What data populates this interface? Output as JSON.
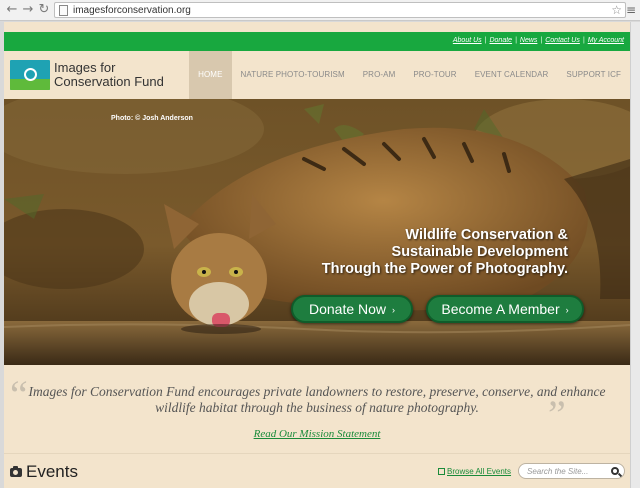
{
  "browser": {
    "url": "imagesforconservation.org",
    "back_glyph": "←",
    "forward_glyph": "→",
    "reload_glyph": "↻",
    "star_glyph": "☆",
    "menu_glyph": "≡"
  },
  "utility_links": [
    "About Us",
    "Donate",
    "News",
    "Contact Us",
    "My Account"
  ],
  "utility_separator": "|",
  "logo": {
    "line1": "Images for",
    "line2": "Conservation Fund",
    "colors": {
      "teal": "#1fa2b3",
      "green": "#5fba3b"
    }
  },
  "nav": {
    "items": [
      {
        "label": "HOME",
        "active": true
      },
      {
        "label": "NATURE PHOTO-TOURISM",
        "active": false
      },
      {
        "label": "PRO-AM",
        "active": false
      },
      {
        "label": "PRO-TOUR",
        "active": false
      },
      {
        "label": "EVENT CALENDAR",
        "active": false
      },
      {
        "label": "SUPPORT ICF",
        "active": false
      }
    ]
  },
  "hero": {
    "credit": "Photo: © Josh Anderson",
    "tagline_lines": [
      "Wildlife Conservation &",
      "Sustainable Development",
      "Through the Power of Photography."
    ],
    "donate_label": "Donate Now",
    "member_label": "Become A Member",
    "button_arrow": "›",
    "button_color": "#1e7d3f"
  },
  "mission": {
    "open_quote": "“",
    "close_quote": "”",
    "text": "Images for Conservation Fund encourages private landowners to restore, preserve, conserve, and enhance wildlife habitat through the business of nature photography.",
    "link": "Read Our Mission Statement"
  },
  "events": {
    "title": "Events",
    "browse": "Browse All Events",
    "search_placeholder": "Search the Site..."
  },
  "colors": {
    "brand_green": "#18a83f",
    "page_bg": "#f3e4cc",
    "link_green": "#1a8b3a"
  }
}
